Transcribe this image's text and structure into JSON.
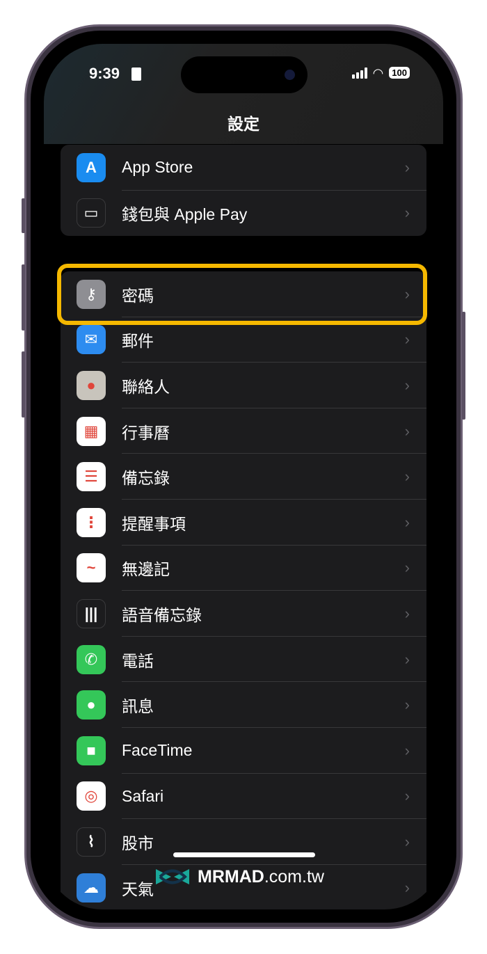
{
  "status_bar": {
    "time": "9:39",
    "battery": "100"
  },
  "header": {
    "title": "設定"
  },
  "groups": [
    {
      "items": [
        {
          "label": "App Store",
          "icon": "app-store-icon",
          "color": "#1a8cf0"
        },
        {
          "label": "錢包與 Apple Pay",
          "icon": "wallet-icon",
          "color": "#1c1c1e"
        }
      ]
    },
    {
      "items": [
        {
          "label": "密碼",
          "icon": "key-icon",
          "color": "#8e8e93"
        },
        {
          "label": "郵件",
          "icon": "mail-icon",
          "color": "#2d8cf0"
        },
        {
          "label": "聯絡人",
          "icon": "contacts-icon",
          "color": "#c8c4bc"
        },
        {
          "label": "行事曆",
          "icon": "calendar-icon",
          "color": "#ffffff"
        },
        {
          "label": "備忘錄",
          "icon": "notes-icon",
          "color": "#ffffff"
        },
        {
          "label": "提醒事項",
          "icon": "reminders-icon",
          "color": "#ffffff"
        },
        {
          "label": "無邊記",
          "icon": "freeform-icon",
          "color": "#ffffff"
        },
        {
          "label": "語音備忘錄",
          "icon": "voice-memos-icon",
          "color": "#1c1c1e"
        },
        {
          "label": "電話",
          "icon": "phone-icon",
          "color": "#34c759"
        },
        {
          "label": "訊息",
          "icon": "messages-icon",
          "color": "#34c759"
        },
        {
          "label": "FaceTime",
          "icon": "facetime-icon",
          "color": "#34c759"
        },
        {
          "label": "Safari",
          "icon": "safari-icon",
          "color": "#ffffff"
        },
        {
          "label": "股市",
          "icon": "stocks-icon",
          "color": "#1c1c1e"
        },
        {
          "label": "天氣",
          "icon": "weather-icon",
          "color": "#2f7fd8"
        }
      ]
    }
  ],
  "highlight_color": "#f5b800",
  "watermark": {
    "brand": "MRMAD",
    "domain": ".com.tw"
  }
}
